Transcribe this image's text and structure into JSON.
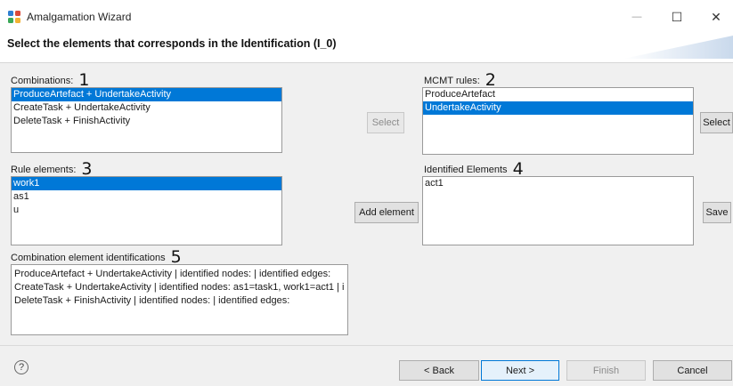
{
  "window": {
    "title": "Amalgamation Wizard",
    "minimize_glyph": "—",
    "maximize_glyph": "☐",
    "close_glyph": "✕",
    "accent_color": "#0078d7"
  },
  "header": {
    "title": "Select the elements that corresponds in the Identification (I_0)"
  },
  "combinations": {
    "label": "Combinations:",
    "number": "1",
    "items": [
      {
        "label": "ProduceArtefact + UndertakeActivity",
        "selected": true
      },
      {
        "label": "CreateTask + UndertakeActivity",
        "selected": false
      },
      {
        "label": "DeleteTask + FinishActivity",
        "selected": false
      }
    ]
  },
  "mcmt_rules": {
    "label": "MCMT rules:",
    "number": "2",
    "items": [
      {
        "label": "ProduceArtefact",
        "selected": false
      },
      {
        "label": "UndertakeActivity",
        "selected": true
      }
    ]
  },
  "rule_elements": {
    "label": "Rule elements:",
    "number": "3",
    "items": [
      {
        "label": "work1",
        "selected": true
      },
      {
        "label": "as1",
        "selected": false
      },
      {
        "label": "u",
        "selected": false
      }
    ]
  },
  "identified_elements": {
    "label": "Identified Elements",
    "number": "4",
    "items": [
      {
        "label": "act1",
        "selected": false
      }
    ]
  },
  "combination_identifications": {
    "label": "Combination element identifications",
    "number": "5",
    "lines": [
      "ProduceArtefact + UndertakeActivity | identified nodes:  | identified edges:",
      "CreateTask + UndertakeActivity | identified nodes: as1=task1, work1=act1 | i",
      "DeleteTask + FinishActivity | identified nodes:  | identified edges:"
    ]
  },
  "buttons": {
    "select_middle": "Select",
    "select_right": "Select",
    "add_element": "Add element",
    "save": "Save"
  },
  "footer": {
    "help_glyph": "?",
    "back": "< Back",
    "next": "Next >",
    "finish": "Finish",
    "cancel": "Cancel"
  }
}
